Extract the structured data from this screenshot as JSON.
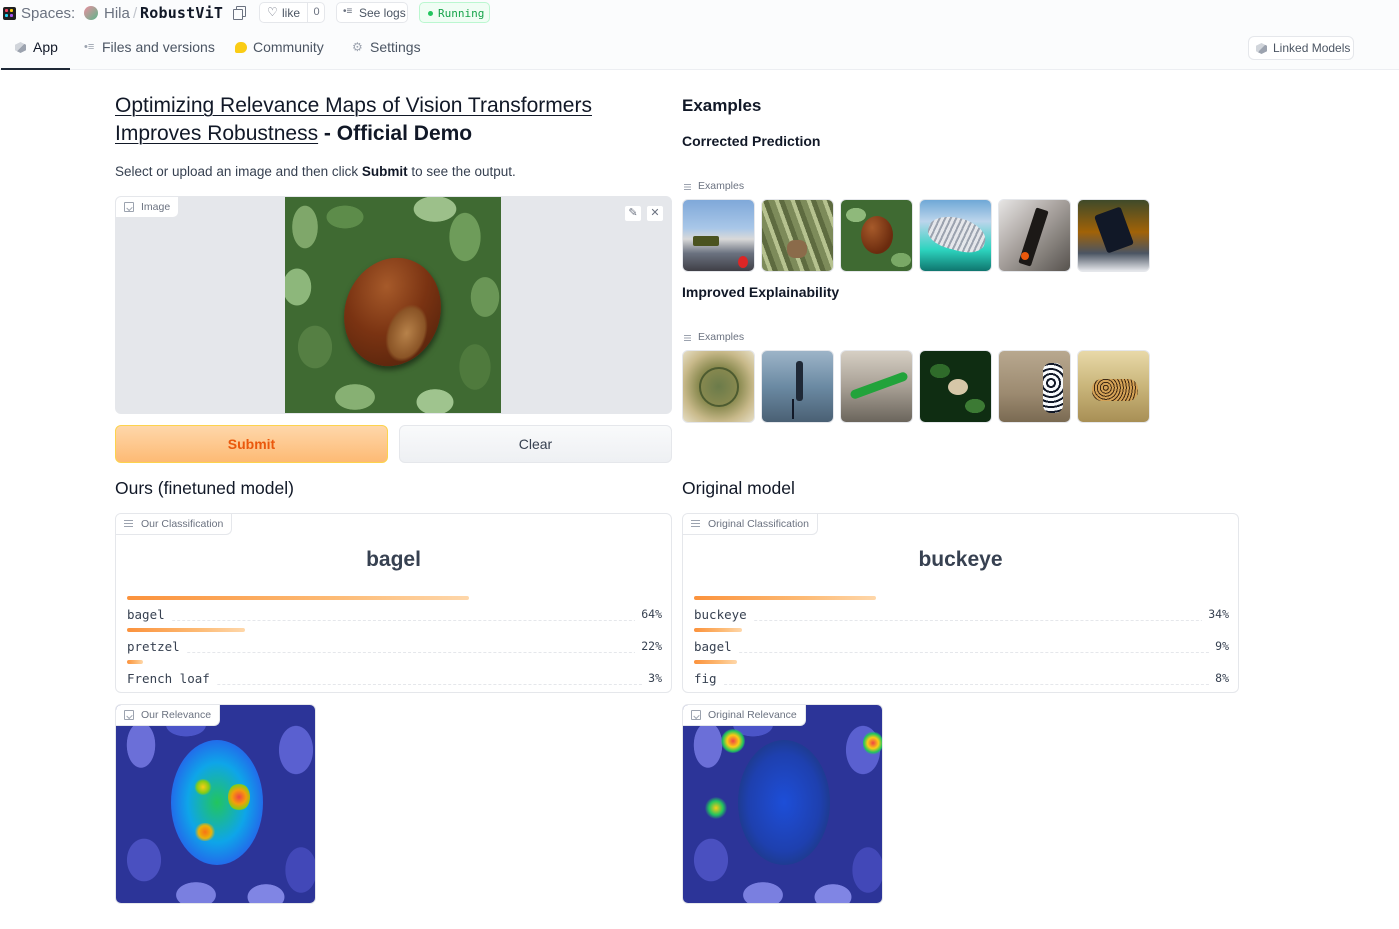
{
  "header": {
    "spaces_label": "Spaces:",
    "owner": "Hila",
    "separator": "/",
    "repo": "RobustViT",
    "like_label": "like",
    "like_count": "0",
    "logs_label": "See logs",
    "status": "Running",
    "linked_models": "Linked Models"
  },
  "tabs": [
    {
      "label": "App",
      "icon": "cube-icon",
      "active": true
    },
    {
      "label": "Files and versions",
      "icon": "files-icon"
    },
    {
      "label": "Community",
      "icon": "community-icon"
    },
    {
      "label": "Settings",
      "icon": "gear-icon"
    }
  ],
  "demo": {
    "title_link": "Optimizing Relevance Maps of Vision Transformers Improves Robustness",
    "title_suffix": " - Official Demo",
    "desc_before": "Select or upload an image and then click ",
    "desc_bold": "Submit",
    "desc_after": " to see the output.",
    "image_label": "Image",
    "submit_label": "Submit",
    "clear_label": "Clear"
  },
  "ours": {
    "heading": "Ours (finetuned model)",
    "box_label": "Our Classification",
    "top_label": "bagel",
    "confidences": [
      {
        "label": "bagel",
        "pct": "64%",
        "value": 0.64
      },
      {
        "label": "pretzel",
        "pct": "22%",
        "value": 0.22
      },
      {
        "label": "French loaf",
        "pct": "3%",
        "value": 0.03
      }
    ],
    "relevance_label": "Our Relevance"
  },
  "original": {
    "heading": "Original model",
    "box_label": "Original Classification",
    "top_label": "buckeye",
    "confidences": [
      {
        "label": "buckeye",
        "pct": "34%",
        "value": 0.34
      },
      {
        "label": "bagel",
        "pct": "9%",
        "value": 0.09
      },
      {
        "label": "fig",
        "pct": "8%",
        "value": 0.08
      }
    ],
    "relevance_label": "Original Relevance"
  },
  "examples": {
    "heading": "Examples",
    "group1_title": "Corrected Prediction",
    "group1_chip": "Examples",
    "group2_title": "Improved Explainability",
    "group2_chip": "Examples"
  },
  "colors": {
    "accent": "#fb923c",
    "submit_text": "#ea580c",
    "running": "#16a34a"
  }
}
